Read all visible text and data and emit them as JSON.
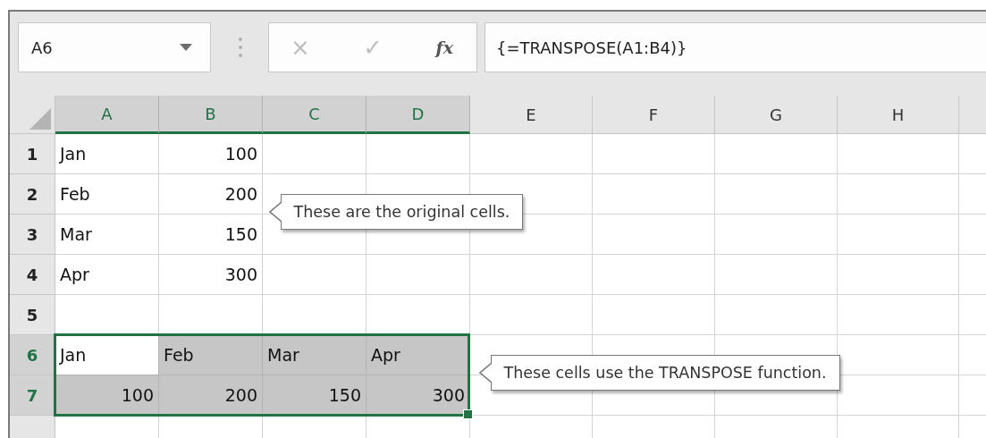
{
  "formula_bar": {
    "name_box": "A6",
    "cancel": "×",
    "enter": "✓",
    "function_label": "fx",
    "formula": "{=TRANSPOSE(A1:B4)}"
  },
  "columns": [
    {
      "label": "A",
      "selected": true
    },
    {
      "label": "B",
      "selected": true
    },
    {
      "label": "C",
      "selected": true
    },
    {
      "label": "D",
      "selected": true
    },
    {
      "label": "E",
      "selected": false
    },
    {
      "label": "F",
      "selected": false
    },
    {
      "label": "G",
      "selected": false
    },
    {
      "label": "H",
      "selected": false
    }
  ],
  "rows": [
    {
      "label": "1",
      "selected": false,
      "cells": [
        {
          "value": "Jan",
          "kind": "text",
          "selected": false
        },
        {
          "value": "100",
          "kind": "number",
          "selected": false
        }
      ]
    },
    {
      "label": "2",
      "selected": false,
      "cells": [
        {
          "value": "Feb",
          "kind": "text",
          "selected": false
        },
        {
          "value": "200",
          "kind": "number",
          "selected": false
        }
      ]
    },
    {
      "label": "3",
      "selected": false,
      "cells": [
        {
          "value": "Mar",
          "kind": "text",
          "selected": false
        },
        {
          "value": "150",
          "kind": "number",
          "selected": false
        }
      ]
    },
    {
      "label": "4",
      "selected": false,
      "cells": [
        {
          "value": "Apr",
          "kind": "text",
          "selected": false
        },
        {
          "value": "300",
          "kind": "number",
          "selected": false
        }
      ]
    },
    {
      "label": "5",
      "selected": false,
      "cells": []
    },
    {
      "label": "6",
      "selected": true,
      "cells": [
        {
          "value": "Jan",
          "kind": "text",
          "selected": true,
          "active": true
        },
        {
          "value": "Feb",
          "kind": "text",
          "selected": true,
          "active": false
        },
        {
          "value": "Mar",
          "kind": "text",
          "selected": true,
          "active": false
        },
        {
          "value": "Apr",
          "kind": "text",
          "selected": true,
          "active": false
        }
      ]
    },
    {
      "label": "7",
      "selected": true,
      "cells": [
        {
          "value": "100",
          "kind": "number",
          "selected": true,
          "active": false
        },
        {
          "value": "200",
          "kind": "number",
          "selected": true,
          "active": false
        },
        {
          "value": "150",
          "kind": "number",
          "selected": true,
          "active": false
        },
        {
          "value": "300",
          "kind": "number",
          "selected": true,
          "active": false
        }
      ]
    }
  ],
  "callouts": [
    "These are the original cells.",
    "These cells use the TRANSPOSE function."
  ]
}
